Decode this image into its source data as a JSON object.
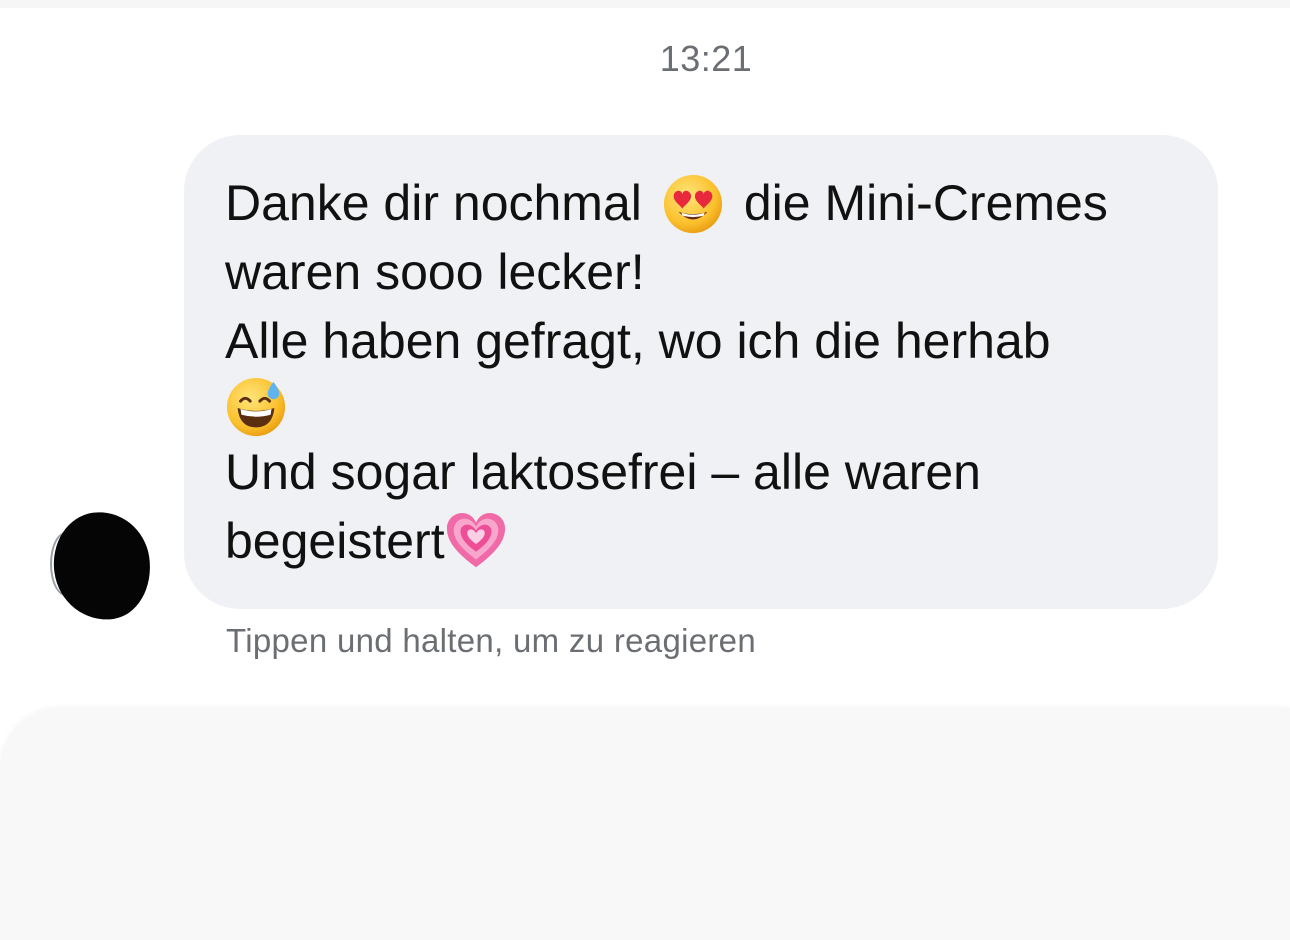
{
  "timestamp": "13:21",
  "message": {
    "line1_a": "Danke dir nochmal",
    "line1_emoji": "heart-eyes-emoji",
    "line1_b": "die Mini-Cremes",
    "line2": "waren sooo lecker!",
    "line3": "Alle haben gefragt, wo ich die herhab",
    "line4_emoji": "grinning-sweat-emoji",
    "line5": "Und sogar laktosefrei – alle waren",
    "line6": "begeistert",
    "line6_emoji": "growing-heart-emoji"
  },
  "hint": "Tippen und halten, um zu reagieren",
  "colors": {
    "bubble": "#eff1f4",
    "text": "#111111",
    "secondary_text": "#6b6e73",
    "background": "#ffffff"
  }
}
